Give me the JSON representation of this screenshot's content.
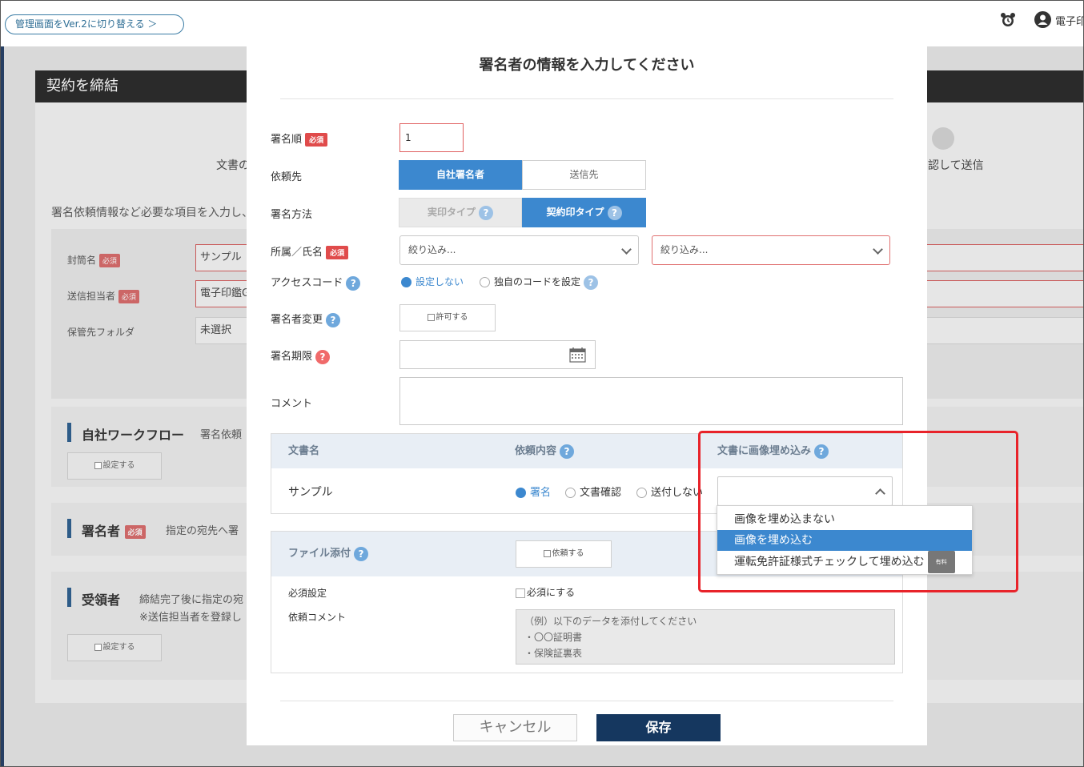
{
  "topbar": {
    "switch_label": "管理画面をVer.2に切り替える ＞",
    "user_name": "電子印"
  },
  "background": {
    "card_title": "契約を締結",
    "step_left": "文書の",
    "step_right": "認して送信",
    "intro": "署名依頼情報など必要な項目を入力し、",
    "fields": [
      {
        "label": "封筒名",
        "required": "必須",
        "value": "サンプル"
      },
      {
        "label": "送信担当者",
        "required": "必須",
        "value": "電子印鑑G"
      },
      {
        "label": "保管先フォルダ",
        "value": "未選択"
      }
    ],
    "sections": [
      {
        "title": "自社ワークフロー",
        "note": "署名依頼",
        "button": "設定する"
      },
      {
        "title": "署名者",
        "required": "必須",
        "note": "指定の宛先へ署"
      },
      {
        "title": "受領者",
        "note": "締結完了後に指定の宛",
        "note2": "※送信担当者を登録し",
        "button": "設定する"
      }
    ]
  },
  "modal": {
    "title": "署名者の情報を入力してください",
    "required_badge": "必須",
    "sign_order": {
      "label": "署名順",
      "value": "1"
    },
    "request_to": {
      "label": "依頼先",
      "options": [
        "自社署名者",
        "送信先"
      ],
      "selected": 0
    },
    "sign_method": {
      "label": "署名方法",
      "options": [
        "実印タイプ",
        "契約印タイプ"
      ],
      "selected": 1
    },
    "affiliation": {
      "label": "所属／氏名",
      "placeholder1": "絞り込み...",
      "placeholder2": "絞り込み..."
    },
    "access_code": {
      "label": "アクセスコード",
      "options": [
        "設定しない",
        "独自のコードを設定"
      ],
      "selected": 0
    },
    "signer_change": {
      "label": "署名者変更",
      "button": "許可する"
    },
    "deadline": {
      "label": "署名期限",
      "value": ""
    },
    "comment": {
      "label": "コメント",
      "value": ""
    },
    "doc_table": {
      "headers": [
        "文書名",
        "依頼内容",
        "文書に画像埋め込み"
      ],
      "row": {
        "name": "サンプル",
        "request_options": [
          "署名",
          "文書確認",
          "送付しない"
        ],
        "request_selected": 0,
        "embed_value": ""
      }
    },
    "embed_dropdown": {
      "options": [
        "画像を埋め込まない",
        "画像を埋め込む",
        "運転免許証様式チェックして埋め込む"
      ],
      "selected": 1,
      "paid_badge": "有料"
    },
    "file_attach": {
      "label": "ファイル添付",
      "button": "依頼する",
      "required_label": "必須設定",
      "required_checkbox": "必須にする",
      "comment_label": "依頼コメント",
      "comment_placeholder": "（例）以下のデータを添付してください\n・〇〇証明書\n・保険証裏表"
    },
    "buttons": {
      "cancel": "キャンセル",
      "save": "保存"
    }
  },
  "colors": {
    "accent": "#3c88cf",
    "save": "#15375f",
    "required": "#e04b4b",
    "highlight": "#e8232a"
  }
}
